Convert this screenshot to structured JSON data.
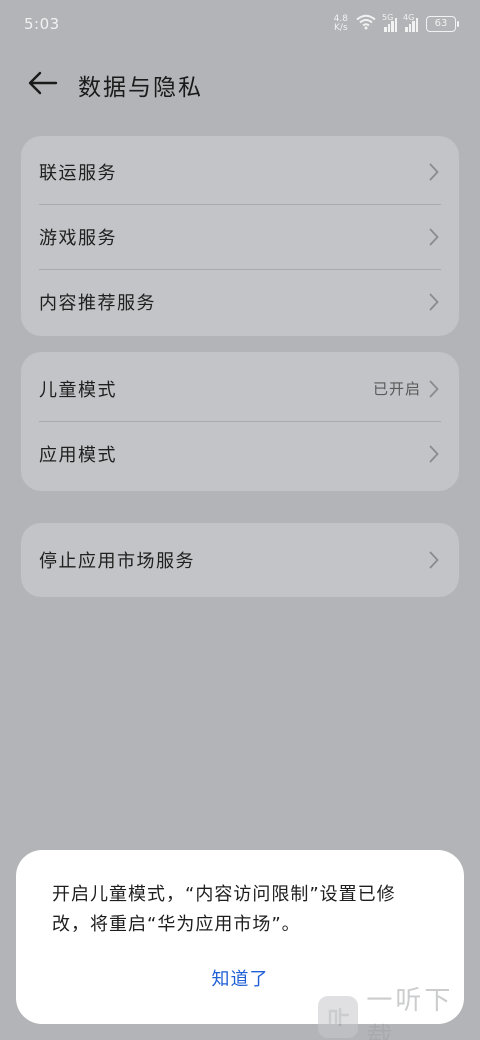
{
  "status_bar": {
    "time": "5:03",
    "net_speed_value": "4.8",
    "net_speed_unit": "K/s",
    "signal_1_label": "5G",
    "signal_2_label": "4G",
    "battery": "63"
  },
  "header": {
    "title": "数据与隐私"
  },
  "groups": [
    {
      "items": [
        {
          "label": "联运服务"
        },
        {
          "label": "游戏服务"
        },
        {
          "label": "内容推荐服务"
        }
      ]
    },
    {
      "items": [
        {
          "label": "儿童模式",
          "value": "已开启"
        },
        {
          "label": "应用模式"
        }
      ]
    },
    {
      "items": [
        {
          "label": "停止应用市场服务"
        }
      ]
    }
  ],
  "dialog": {
    "message": "开启儿童模式，“内容访问限制”设置已修改，将重启“华为应用市场”。",
    "button": "知道了"
  },
  "watermark": {
    "text": "一听下载"
  },
  "icons": {
    "back": "back-arrow-icon",
    "chevron": "chevron-right-icon",
    "wifi": "wifi-icon",
    "signal": "signal-bars-icon",
    "battery": "battery-icon"
  },
  "colors": {
    "background_dimmed": "#b3b4b8",
    "card": "#c3c4c7",
    "dialog": "#ffffff",
    "accent": "#1f5fd6"
  }
}
